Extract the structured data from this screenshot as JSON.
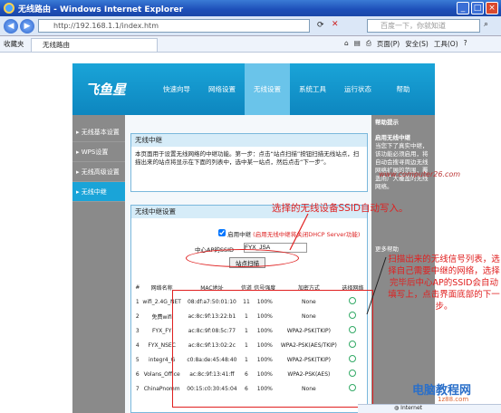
{
  "window": {
    "title": "无线路由 - Windows Internet Explorer"
  },
  "address": {
    "url": "http://192.168.1.1/index.htm",
    "search_placeholder": "百度一下，你就知道"
  },
  "tabs": {
    "favorites_label": "收藏夹",
    "active_tab": "无线路由",
    "toolbar_items": [
      "页面(P)",
      "安全(S)",
      "工具(O)"
    ]
  },
  "site": {
    "logo": "飞鱼星",
    "nav": [
      "快速向导",
      "网络设置",
      "无线设置",
      "系统工具",
      "运行状态",
      "帮助"
    ],
    "sidebar": [
      "无线基本设置",
      "WPS设置",
      "无线高级设置",
      "无线中继"
    ],
    "box1": {
      "title": "无线中继",
      "desc": "本页面用于设置无线网络的中继功能。第一步：点击“站点扫描”按钮扫描无线站点，扫描出来的站点将显示在下面的列表中，选中某一站点，然后点击“下一步”。"
    },
    "box2": {
      "title": "无线中继设置",
      "enable_label": "启用中继",
      "enable_note": "(启用无线中继将关闭DHCP Server功能)",
      "ssid_label": "中心AP的SSID",
      "ssid_value": "FYX_JSA",
      "scan_button": "站点扫描"
    },
    "table": {
      "headers": [
        "#",
        "网络名称",
        "MAC地址",
        "信道",
        "信号强度",
        "加密方式",
        "选择网络"
      ],
      "rows": [
        [
          "1",
          "wifi_2.4G_NET",
          "08:df:a7:50:01:10",
          "11",
          "100%",
          "None"
        ],
        [
          "2",
          "免费wifi",
          "ac:8c:9f:13:22:b1",
          "1",
          "100%",
          "None"
        ],
        [
          "3",
          "FYX_FY",
          "ac:8c:9f:08:5c:77",
          "1",
          "100%",
          "WPA2-PSK(TKIP)"
        ],
        [
          "4",
          "FYX_NSEC",
          "ac:8c:9f:13:02:2c",
          "1",
          "100%",
          "WPA2-PSK(AES/TKIP)"
        ],
        [
          "5",
          "integr4_G",
          "c0:8a:de:45:48:40",
          "1",
          "100%",
          "WPA2-PSK(TKIP)"
        ],
        [
          "6",
          "Volans_Office",
          "ac:8c:9f:13:41:ff",
          "6",
          "100%",
          "WPA2-PSK(AES)"
        ],
        [
          "7",
          "ChinaPnomm",
          "00:15:c0:30:45:04",
          "6",
          "100%",
          "None"
        ]
      ]
    },
    "right_panel": {
      "title": "帮助提示",
      "subtitle": "启用无线中继",
      "body": "当您下了真实中继，该功能必须启用，将自动会搜寻周边无线网络扩展的范围，覆盖用广大覆盖的无线网络。",
      "more": "更多帮助"
    }
  },
  "annotations": {
    "note1": "选择的无线设备SSID自动写入。",
    "note2": "扫描出来的无线信号列表，选择自己需要中继的网络，选择完毕后中心AP的SSID会自动填写上，点击界面底部的下一步。"
  },
  "watermark": {
    "site": "www.computer26.com",
    "logo": "电脑教程网",
    "url": "1z88.com"
  },
  "status": {
    "zone": "Internet"
  },
  "colors": {
    "accent": "#1aa4d8",
    "annotation": "#e02020"
  }
}
